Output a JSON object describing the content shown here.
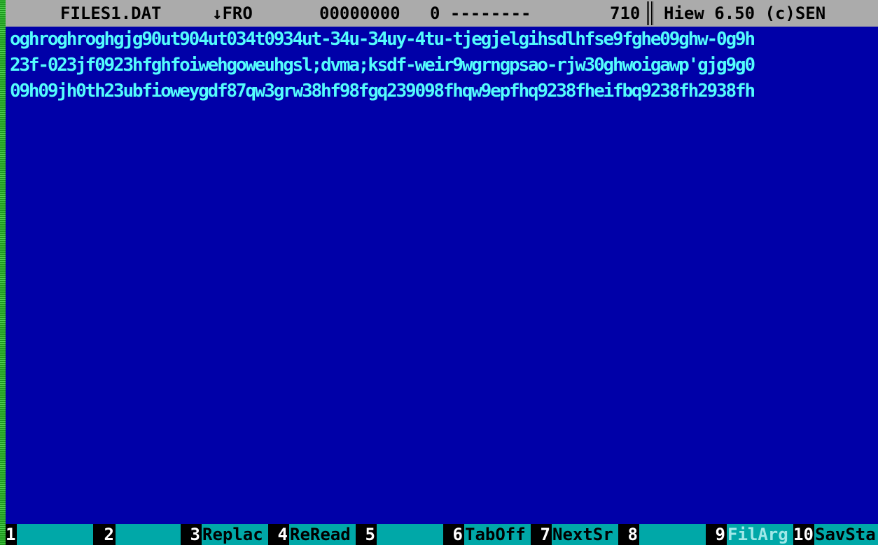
{
  "app": {
    "name": "Hiew 6.50 (c)SEN"
  },
  "status_bar": {
    "filename": "FILES1.DAT",
    "mode": "↓FRO",
    "offset": "00000000",
    "column": "0 --------",
    "size": "710",
    "title": "Hiew 6.50 (c)SEN"
  },
  "content": {
    "lines": [
      "oghroghroghgjg90ut904ut034t0934ut-34u-34uy-4tu-tjegjelgihsdlhfse9fghe09ghw-0g9h",
      "23f-023jf0923hfghfoiwehgoweuhgsl;dvma;ksdf-weir9wgrngpsao-rjw30ghwoigawp'gjg9g0",
      "09h09jh0th23ubfioweygdf87qw3grw38hf98fgq239098fhqw9epfhq9238fheifbq9238fh2938fh"
    ]
  },
  "function_keys": [
    {
      "num": "1",
      "label": ""
    },
    {
      "num": "2",
      "label": ""
    },
    {
      "num": "3",
      "label": "Replac"
    },
    {
      "num": "4",
      "label": "ReRead"
    },
    {
      "num": "5",
      "label": ""
    },
    {
      "num": "6",
      "label": "TabOff"
    },
    {
      "num": "7",
      "label": "NextSr"
    },
    {
      "num": "8",
      "label": ""
    },
    {
      "num": "9",
      "label": "FilArg"
    },
    {
      "num": "10",
      "label": "SavSta"
    }
  ],
  "colors": {
    "background": "#0000a8",
    "text": "#54fcfc",
    "status_bar": "#ababab",
    "fkey_label_bg": "#00a8a8"
  }
}
